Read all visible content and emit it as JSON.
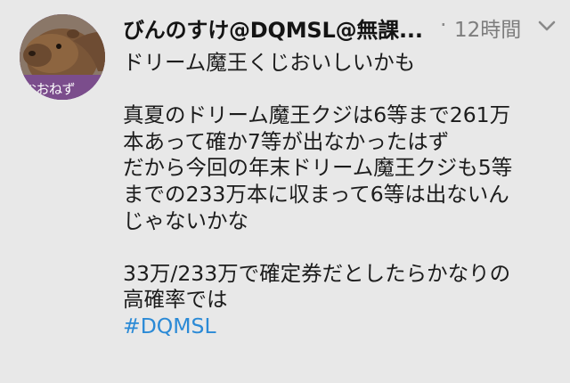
{
  "tweet": {
    "author_name": "びんのすけ@DQMSL@無課...",
    "separator": "·",
    "timestamp": "12時間",
    "avatar_text": "おおねず",
    "lines": [
      "ドリーム魔王くじおいしいかも",
      "",
      "真夏のドリーム魔王クジは6等まで261万",
      "本あって確か7等が出なかったはず",
      "だから今回の年末ドリーム魔王クジも5等",
      "までの233万本に収まって6等は出ないん",
      "じゃないかな",
      "",
      "33万/233万で確定券だとしたらかなりの",
      "高確率では"
    ],
    "hashtag": "#DQMSL"
  },
  "icons": {
    "menu": "chevron-down-icon"
  },
  "colors": {
    "background": "#e8e8e8",
    "hashtag": "#2b8ad6",
    "avatar_ring": "#7a4e8e"
  }
}
